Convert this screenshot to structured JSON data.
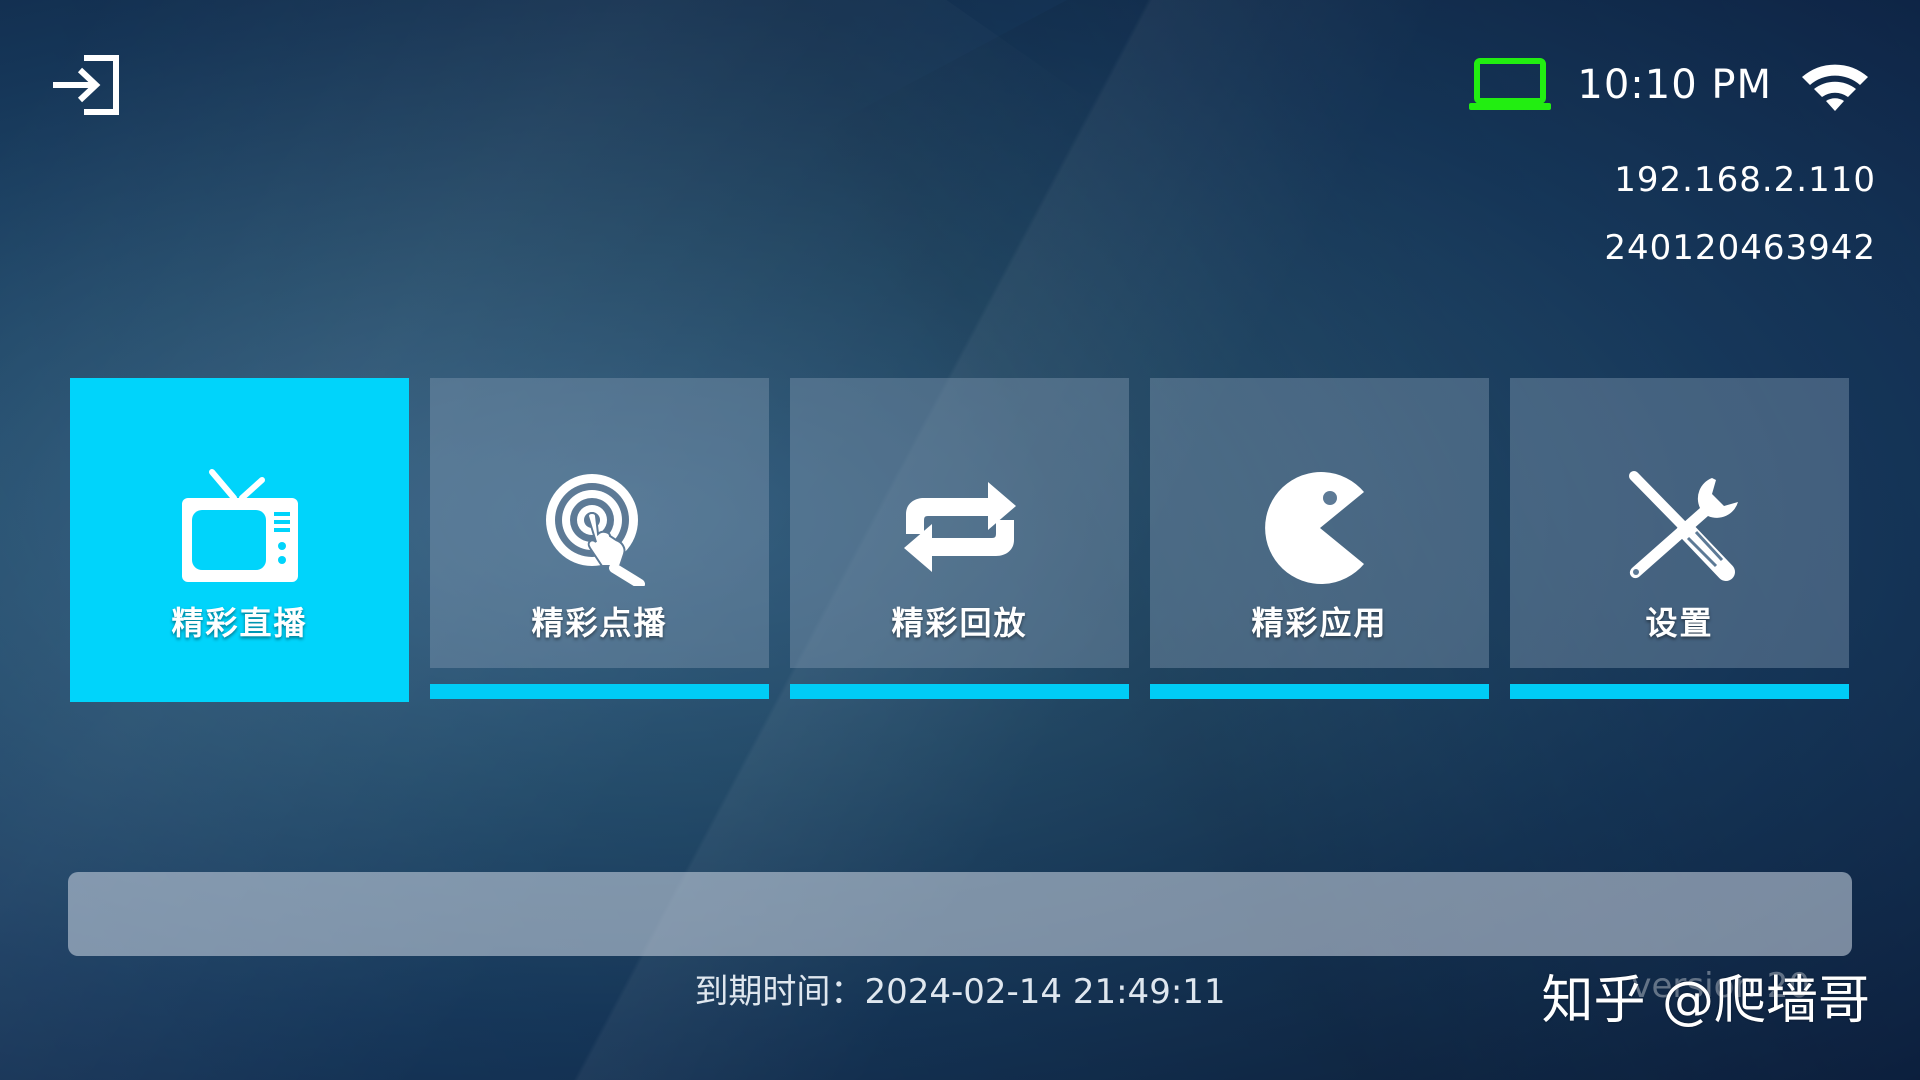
{
  "header": {
    "clock": "10:10 PM",
    "ip_address": "192.168.2.110",
    "device_serial": "240120463942",
    "colors": {
      "device_icon": "#22ee11",
      "text": "#ffffff"
    },
    "icons": {
      "login": "login-arrow-icon",
      "device": "laptop-icon",
      "network": "wifi-icon"
    }
  },
  "menu": {
    "tiles": [
      {
        "label": "精彩直播",
        "icon": "tv-icon",
        "active": true
      },
      {
        "label": "精彩点播",
        "icon": "tap-target-icon",
        "active": false
      },
      {
        "label": "精彩回放",
        "icon": "repeat-icon",
        "active": false
      },
      {
        "label": "精彩应用",
        "icon": "pacman-icon",
        "active": false
      },
      {
        "label": "设置",
        "icon": "tools-icon",
        "active": false
      }
    ],
    "colors": {
      "active_tile": "#00d4fb",
      "underline": "#00ccf6"
    }
  },
  "footer": {
    "expiry_label": "到期时间：",
    "expiry_value": "2024-02-14 21:49:11",
    "version_text": "version 20",
    "watermark": "知乎 @爬墙哥"
  }
}
